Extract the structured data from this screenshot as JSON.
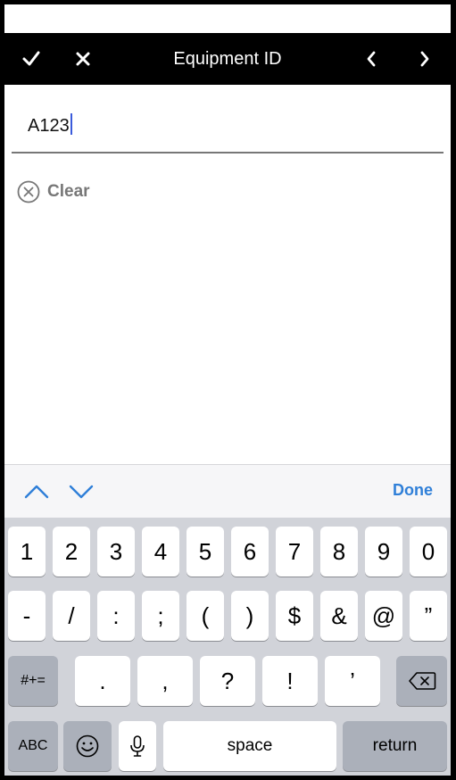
{
  "navbar": {
    "title": "Equipment ID",
    "icons": [
      "checkmark-icon",
      "close-icon",
      "chevron-left-icon",
      "chevron-right-icon"
    ]
  },
  "input": {
    "value": "A123"
  },
  "clear": {
    "label": "Clear",
    "icon": "circle-x-icon"
  },
  "accessory": {
    "done_label": "Done",
    "icons": [
      "chevron-up-icon",
      "chevron-down-icon"
    ]
  },
  "keyboard": {
    "row1": [
      "1",
      "2",
      "3",
      "4",
      "5",
      "6",
      "7",
      "8",
      "9",
      "0"
    ],
    "row2": [
      "-",
      "/",
      ":",
      ";",
      "(",
      ")",
      "$",
      "&",
      "@",
      "”"
    ],
    "row3": {
      "symbols_label": "#+=",
      "keys": [
        ".",
        ",",
        "?",
        "!",
        "’"
      ],
      "backspace_icon": "backspace-icon"
    },
    "row4": {
      "abc_label": "ABC",
      "emoji_icon": "emoji-icon",
      "mic_icon": "microphone-icon",
      "space_label": "space",
      "return_label": "return"
    }
  },
  "colors": {
    "navbar_bg": "#000000",
    "accent": "#2f7fd8",
    "keyboard_bg": "#d1d3d9",
    "key_gray": "#abb0ba"
  }
}
